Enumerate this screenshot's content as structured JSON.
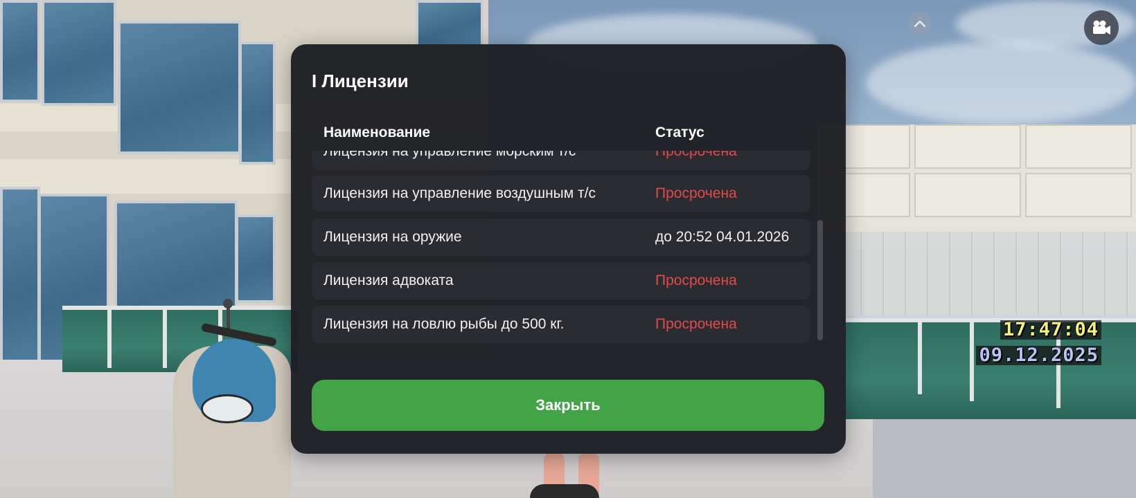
{
  "dialog": {
    "title": "I Лицензии",
    "columns": {
      "name": "Наименование",
      "status": "Статус"
    },
    "rows": [
      {
        "name": "Лицензия на управление морским т/с",
        "status": "Просрочена",
        "status_type": "expired"
      },
      {
        "name": "Лицензия на управление воздушным т/с",
        "status": "Просрочена",
        "status_type": "expired"
      },
      {
        "name": "Лицензия на оружие",
        "status": "до 20:52 04.01.2026",
        "status_type": "valid"
      },
      {
        "name": "Лицензия адвоката",
        "status": "Просрочена",
        "status_type": "expired"
      },
      {
        "name": "Лицензия на ловлю рыбы до 500 кг.",
        "status": "Просрочена",
        "status_type": "expired"
      }
    ],
    "scroll_position": 0.55,
    "close_label": "Закрыть"
  },
  "hud": {
    "time": "17:47:04",
    "date": "09.12.2025",
    "chevron_icon": "chevron-up-icon",
    "camera_icon": "video-camera-icon"
  },
  "colors": {
    "panel_bg": "#1e1f24",
    "row_bg": "#2b2c32",
    "expired": "#e04b4b",
    "close_button": "#43a447",
    "clock_time": "#f5f37a",
    "clock_date": "#b8c4f5"
  }
}
